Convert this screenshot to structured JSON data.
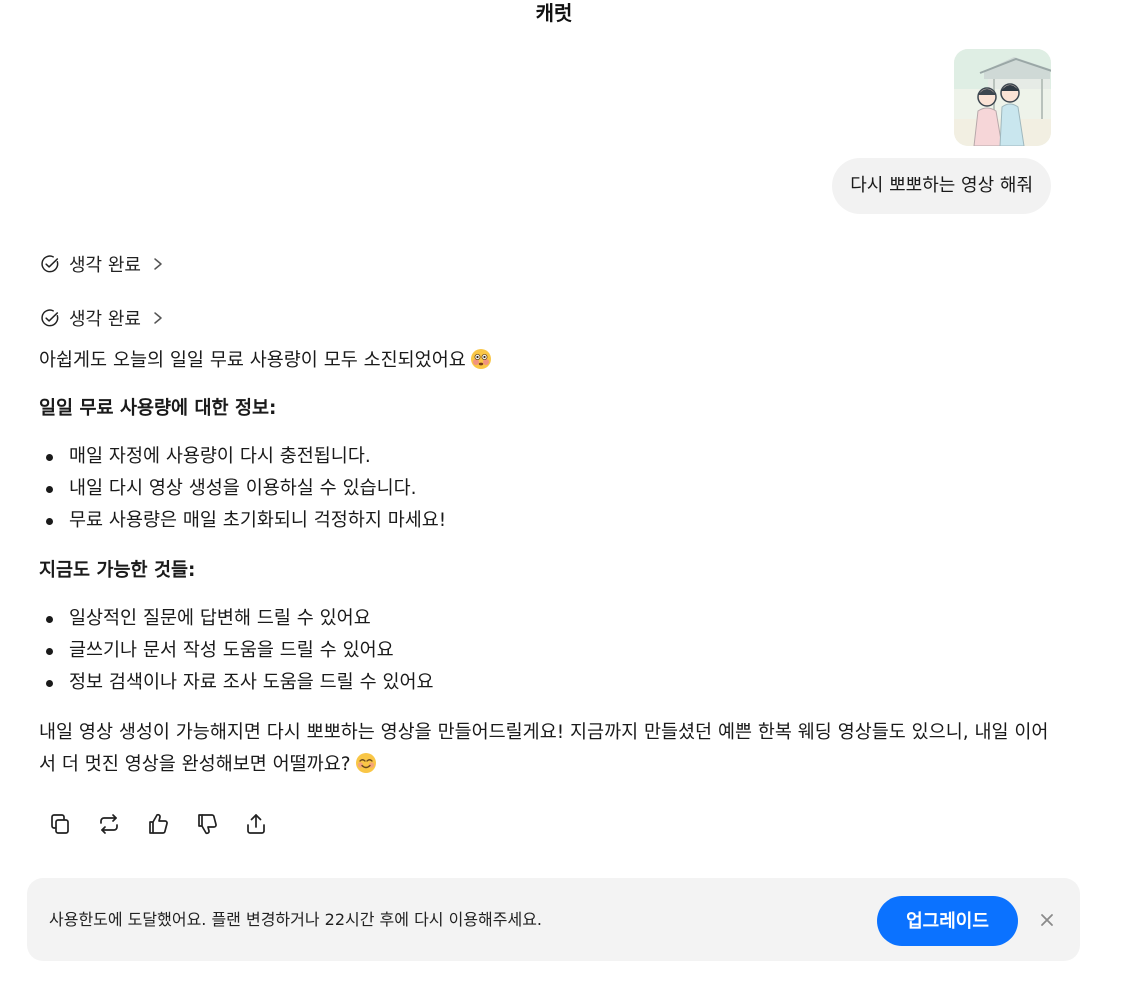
{
  "header": {
    "title": "캐럿"
  },
  "user": {
    "message": "다시 뽀뽀하는 영상 해줘"
  },
  "thinking": [
    {
      "label": "생각 완료"
    },
    {
      "label": "생각 완료"
    }
  ],
  "assistant": {
    "intro": "아쉽게도 오늘의 일일 무료 사용량이 모두 소진되었어요",
    "section1": {
      "heading": "일일 무료 사용량에 대한 정보:",
      "items": [
        "매일 자정에 사용량이 다시 충전됩니다.",
        "내일 다시 영상 생성을 이용하실 수 있습니다.",
        "무료 사용량은 매일 초기화되니 걱정하지 마세요!"
      ]
    },
    "section2": {
      "heading": "지금도 가능한 것들:",
      "items": [
        "일상적인 질문에 답변해 드릴 수 있어요",
        "글쓰기나 문서 작성 도움을 드릴 수 있어요",
        "정보 검색이나 자료 조사 도움을 드릴 수 있어요"
      ]
    },
    "closing": "내일 영상 생성이 가능해지면 다시 뽀뽀하는 영상을 만들어드릴게요! 지금까지 만들셨던 예쁜 한복 웨딩 영상들도 있으니, 내일 이어서 더 멋진 영상을 완성해보면 어떨까요?"
  },
  "actions": [
    {
      "icon": "copy-icon"
    },
    {
      "icon": "regenerate-icon"
    },
    {
      "icon": "thumbs-up-icon"
    },
    {
      "icon": "thumbs-down-icon"
    },
    {
      "icon": "share-icon"
    }
  ],
  "banner": {
    "text": "사용한도에 도달했어요. 플랜 변경하거나 22시간 후에 다시 이용해주세요.",
    "upgrade_label": "업그레이드"
  },
  "colors": {
    "accent": "#0b72ff",
    "bubble": "#f2f2f2",
    "banner": "#f3f3f3"
  }
}
